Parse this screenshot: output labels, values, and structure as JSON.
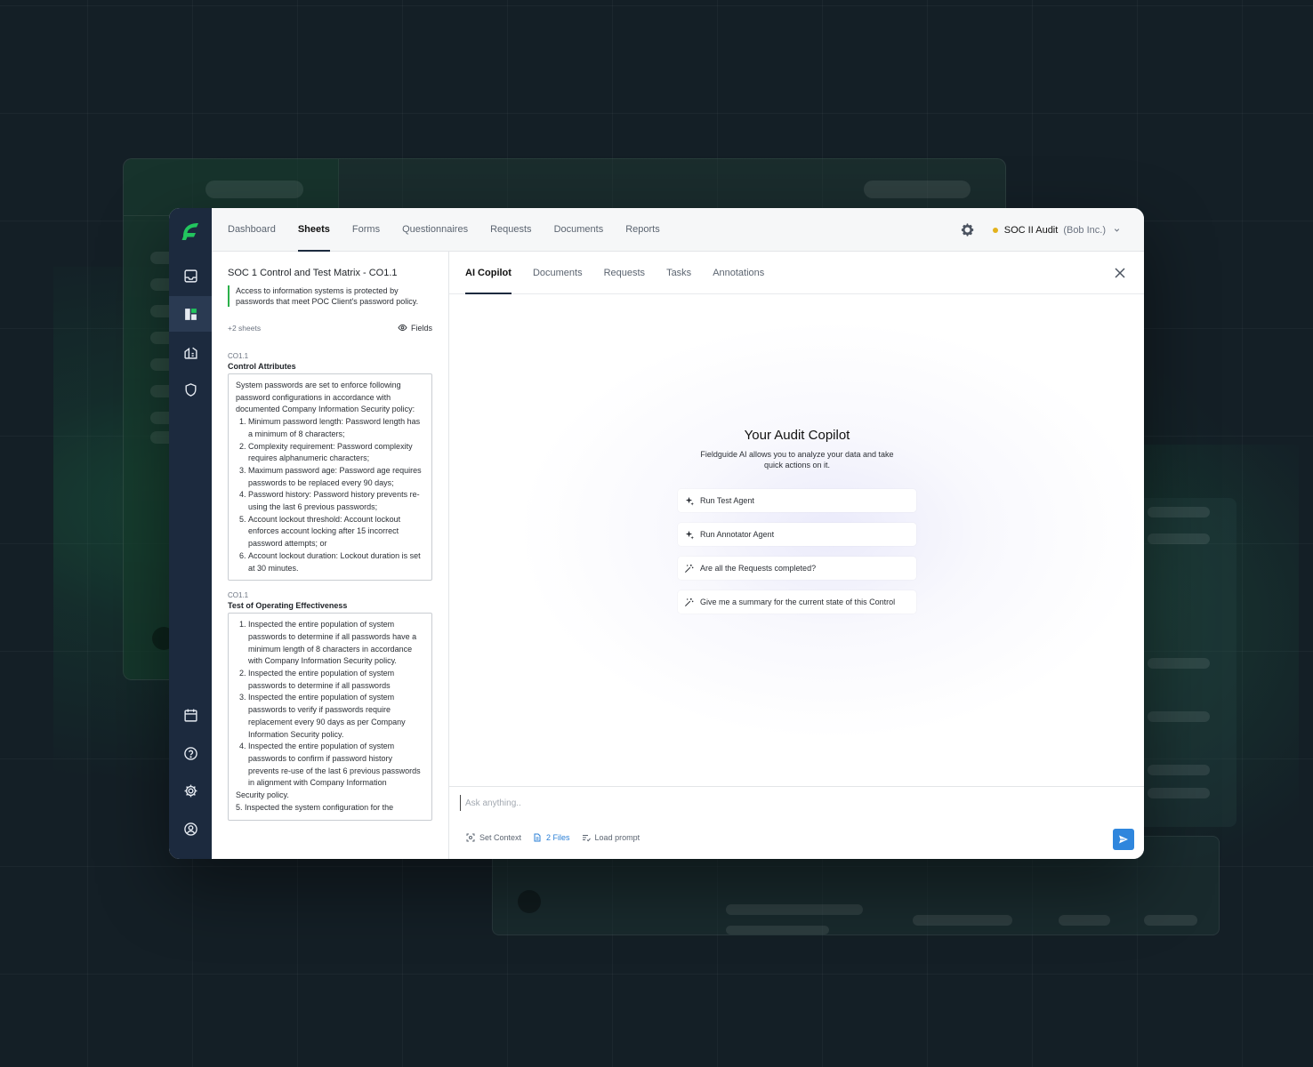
{
  "topnav": {
    "items": [
      {
        "label": "Dashboard",
        "active": false
      },
      {
        "label": "Sheets",
        "active": true
      },
      {
        "label": "Forms",
        "active": false
      },
      {
        "label": "Questionnaires",
        "active": false
      },
      {
        "label": "Requests",
        "active": false
      },
      {
        "label": "Documents",
        "active": false
      },
      {
        "label": "Reports",
        "active": false
      }
    ],
    "audit_name": "SOC II Audit",
    "audit_org": "(Bob Inc.)",
    "status_color": "#e3b21d"
  },
  "rail": {
    "icons": [
      "inbox-icon",
      "sheets-icon",
      "organization-icon",
      "shield-icon",
      "calendar-icon",
      "help-icon",
      "settings-icon",
      "user-icon"
    ],
    "accent": "#22c55e"
  },
  "left": {
    "sheet_title": "SOC 1 Control and Test Matrix - CO1.1",
    "description": "Access to information systems is protected by passwords that meet POC Client's password policy.",
    "sheets_count": "+2 sheets",
    "fields_label": "Fields",
    "sections": [
      {
        "code": "CO1.1",
        "label": "Control Attributes",
        "intro": "System passwords are set to enforce following password configurations in accordance with documented Company Information Security policy:",
        "items": [
          "Minimum password length: Password length has a minimum of 8 characters;",
          "Complexity requirement: Password complexity requires alphanumeric characters;",
          "Maximum password age: Password age requires passwords to be replaced every 90 days;",
          "Password history: Password history prevents re-using the last 6 previous passwords;",
          "Account lockout threshold: Account lockout enforces account locking after 15 incorrect password attempts; or",
          "Account lockout duration: Lockout duration is set at 30 minutes."
        ]
      },
      {
        "code": "CO1.1",
        "label": "Test of Operating Effectiveness",
        "items": [
          "Inspected the entire population of system passwords to determine if all passwords have a minimum length of 8 characters in accordance with Company Information Security policy.",
          "Inspected the entire population of system passwords to determine if all passwords",
          "Inspected the entire population of system passwords to verify if passwords require replacement every 90 days as per Company Information Security policy.",
          "Inspected the entire population of system passwords to confirm if password history prevents re-use of the last 6 previous passwords in alignment with Company Information"
        ],
        "outro": "Security policy.",
        "tail": "5. Inspected the system configuration for the"
      }
    ]
  },
  "right": {
    "tabs": [
      {
        "label": "AI Copilot",
        "active": true
      },
      {
        "label": "Documents",
        "active": false
      },
      {
        "label": "Requests",
        "active": false
      },
      {
        "label": "Tasks",
        "active": false
      },
      {
        "label": "Annotations",
        "active": false
      }
    ],
    "copilot": {
      "title": "Your Audit Copilot",
      "subtitle": "Fieldguide AI allows you to analyze your data and take quick actions on it.",
      "suggestions": [
        {
          "label": "Run Test Agent",
          "icon": "sparkles-icon"
        },
        {
          "label": "Run Annotator Agent",
          "icon": "sparkles-icon"
        },
        {
          "label": "Are all the Requests completed?",
          "icon": "magic-wand-icon"
        },
        {
          "label": "Give me a summary for the current state of this Control",
          "icon": "magic-wand-icon"
        }
      ]
    },
    "composer": {
      "placeholder": "Ask anything..",
      "set_context": "Set Context",
      "files": "2 Files",
      "load_prompt": "Load prompt",
      "send_color": "#2f86dd"
    }
  }
}
